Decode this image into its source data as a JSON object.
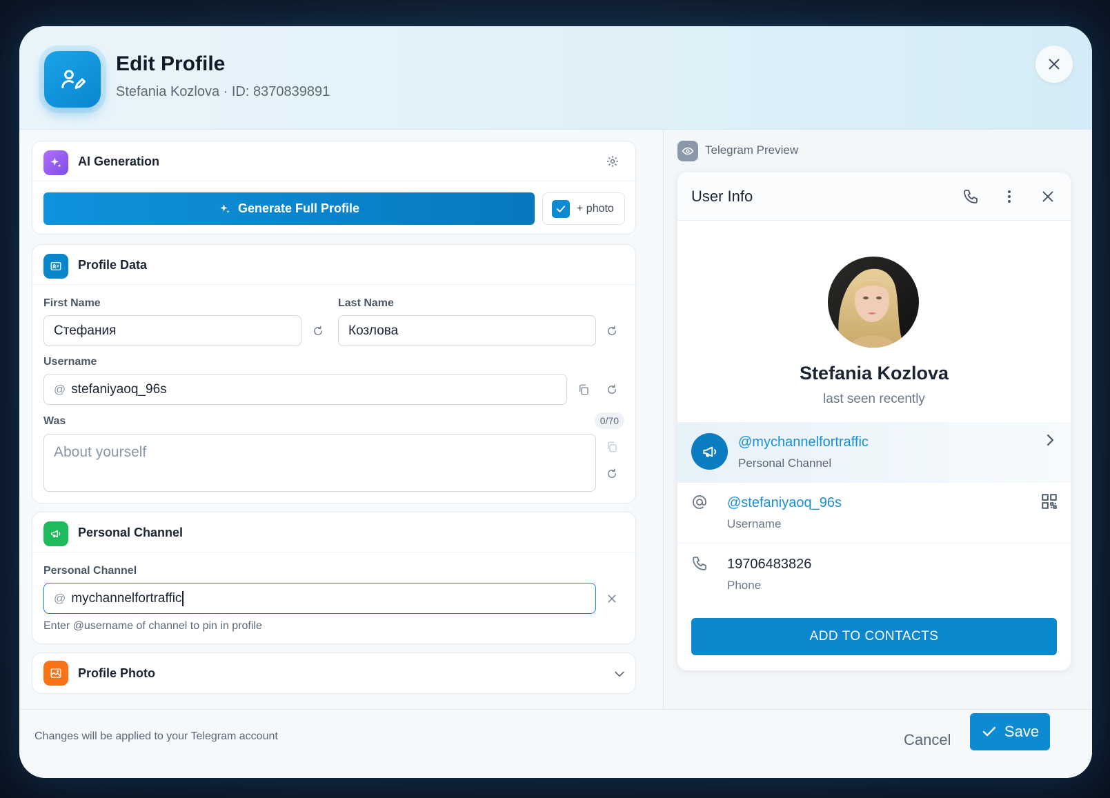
{
  "header": {
    "title": "Edit Profile",
    "subtitle": "Stefania Kozlova · ID: 8370839891"
  },
  "ai": {
    "title": "AI Generation",
    "generate_label": "Generate Full Profile",
    "photo_label": "+ photo",
    "photo_checked": true
  },
  "profile": {
    "title": "Profile Data",
    "first_name_label": "First Name",
    "first_name_value": "Стефания",
    "last_name_label": "Last Name",
    "last_name_value": "Козлова",
    "username_label": "Username",
    "username_prefix": "@",
    "username_value": "stefaniyaoq_96s",
    "bio_label": "Was",
    "bio_counter": "0/70",
    "bio_placeholder": "About yourself"
  },
  "channel": {
    "title": "Personal Channel",
    "field_label": "Personal Channel",
    "prefix": "@",
    "value": "mychannelfortraffic",
    "hint": "Enter @username of channel to pin in profile"
  },
  "photo_section": {
    "title": "Profile Photo"
  },
  "preview": {
    "label": "Telegram Preview",
    "header_title": "User Info",
    "name": "Stefania Kozlova",
    "status": "last seen recently",
    "channel_link": "@mychannelfortraffic",
    "channel_sub": "Personal Channel",
    "username_link": "@stefaniyaoq_96s",
    "username_sub": "Username",
    "phone": "19706483826",
    "phone_sub": "Phone",
    "add_contacts": "ADD TO CONTACTS"
  },
  "footer": {
    "note": "Changes will be applied to your Telegram account",
    "cancel": "Cancel",
    "save": "Save"
  },
  "colors": {
    "accent": "#0c8ad2",
    "ai_icon": "#9b5cf0",
    "profile_icon": "#0a86cc",
    "channel_icon": "#1dbb5b",
    "photo_icon": "#f97316"
  }
}
